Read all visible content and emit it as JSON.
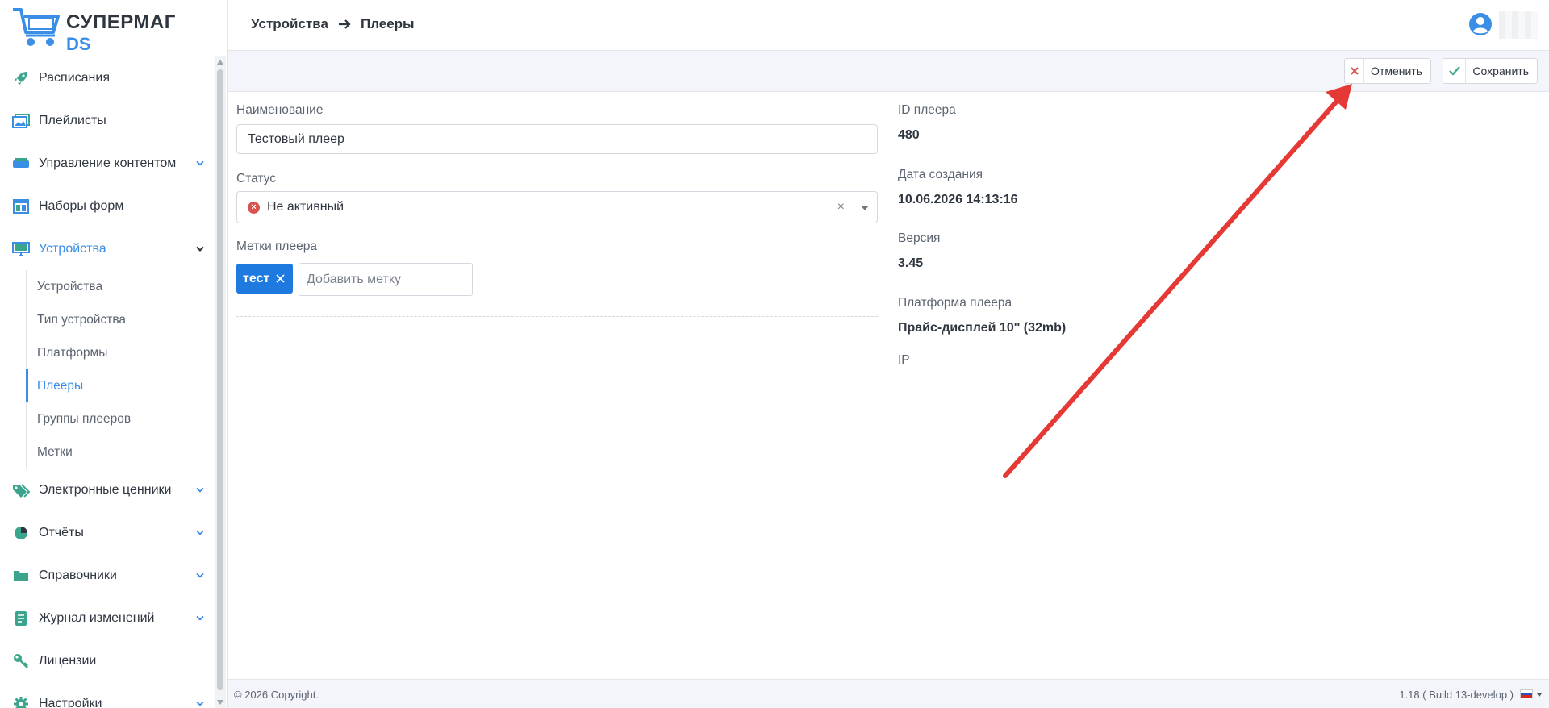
{
  "app": {
    "logo_line1": "СУПЕРМАГ",
    "logo_line2": "DS"
  },
  "header": {
    "breadcrumb_parent": "Устройства",
    "breadcrumb_current": "Плееры"
  },
  "sidebar": {
    "items": [
      {
        "label": "Расписания",
        "icon": "rocket-icon"
      },
      {
        "label": "Плейлисты",
        "icon": "images-icon"
      },
      {
        "label": "Управление контентом",
        "icon": "layers-icon"
      },
      {
        "label": "Наборы форм",
        "icon": "columns-icon"
      },
      {
        "label": "Устройства",
        "icon": "monitor-icon"
      },
      {
        "label": "Электронные ценники",
        "icon": "tags-icon"
      },
      {
        "label": "Отчёты",
        "icon": "pie-chart-icon"
      },
      {
        "label": "Справочники",
        "icon": "folder-icon"
      },
      {
        "label": "Журнал изменений",
        "icon": "journal-icon"
      },
      {
        "label": "Лицензии",
        "icon": "key-icon"
      },
      {
        "label": "Настройки",
        "icon": "gear-icon"
      }
    ],
    "devices_sub": [
      "Устройства",
      "Тип устройства",
      "Платформы",
      "Плееры",
      "Группы плееров",
      "Метки"
    ]
  },
  "toolbar": {
    "cancel_label": "Отменить",
    "save_label": "Сохранить"
  },
  "form": {
    "name_label": "Наименование",
    "name_value": "Тестовый плеер",
    "status_label": "Статус",
    "status_value": "Не активный",
    "status_clear": "×",
    "tags_label": "Метки плеера",
    "tag_value": "тест",
    "tag_placeholder": "Добавить метку"
  },
  "info": {
    "id_label": "ID плеера",
    "id_value": "480",
    "created_label": "Дата создания",
    "created_value": "10.06.2026 14:13:16",
    "version_label": "Версия",
    "version_value": "3.45",
    "platform_label": "Платформа плеера",
    "platform_value": "Прайс-дисплей 10'' (32mb)",
    "ip_label": "IP"
  },
  "footer": {
    "copyright": "© 2026 Copyright.",
    "version": "1.18 ( Build 13-develop )"
  },
  "colors": {
    "accent": "#3a8ee6",
    "tag_bg": "#1f7ae0",
    "icon_teal": "#3aa58c",
    "status_red": "#d9534f",
    "annotation_red": "#e53935"
  }
}
